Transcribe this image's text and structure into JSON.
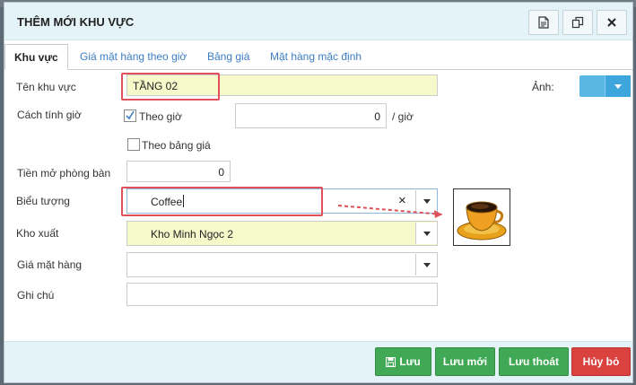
{
  "dialog": {
    "title": "THÊM MỚI KHU VỰC"
  },
  "tabs": [
    {
      "label": "Khu vực"
    },
    {
      "label": "Giá mặt hàng theo giờ"
    },
    {
      "label": "Bảng giá"
    },
    {
      "label": "Mặt hàng mặc định"
    }
  ],
  "form": {
    "ten_khu_vuc": {
      "label": "Tên khu vực",
      "value": "TẦNG 02"
    },
    "anh": {
      "label": "Ảnh:"
    },
    "cach_tinh_gio": {
      "label": "Cách tính giờ",
      "option1": "Theo giờ",
      "option1_checked": true,
      "unit_value": "0",
      "unit_suffix": "/ giờ",
      "option2": "Theo bảng giá",
      "option2_checked": false
    },
    "tien_mo_phong": {
      "label": "Tiền mở phòng bàn",
      "value": "0"
    },
    "bieu_tuong": {
      "label": "Biểu tượng",
      "value": "Coffee",
      "clear_glyph": "×"
    },
    "kho_xuat": {
      "label": "Kho xuất",
      "value": "Kho Minh Ngọc 2"
    },
    "gia_mat_hang": {
      "label": "Giá mặt hàng",
      "value": ""
    },
    "ghi_chu": {
      "label": "Ghi chú",
      "value": ""
    }
  },
  "footer": {
    "save": "Lưu",
    "save_new": "Lưu mới",
    "save_exit": "Lưu thoát",
    "cancel": "Hủy bỏ"
  },
  "colors": {
    "title_bg": "#e3f3f7",
    "highlight_field": "#f6f9c9",
    "accent_green": "#41a955",
    "accent_red": "#d9423f",
    "annotation_red": "#e0505a",
    "image_button": "#58b7e3"
  }
}
